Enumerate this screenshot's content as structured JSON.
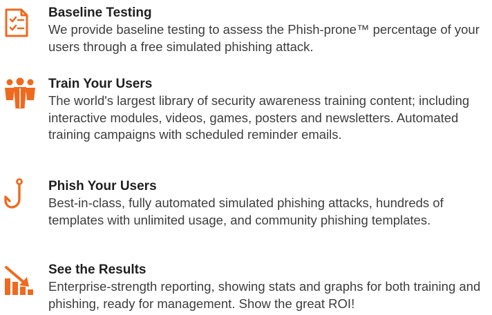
{
  "accent_color": "#ee6a1f",
  "features": [
    {
      "icon": "checklist-icon",
      "title": "Baseline Testing",
      "description": "We provide baseline testing to assess the Phish-prone™ percentage of your users through a free simulated phishing attack."
    },
    {
      "icon": "users-group-icon",
      "title": "Train Your Users",
      "description": "The world's largest library of security awareness training content; including interactive modules, videos, games, posters and newsletters. Automated training campaigns with scheduled reminder emails."
    },
    {
      "icon": "fishing-hook-icon",
      "title": "Phish Your Users",
      "description": "Best-in-class, fully automated simulated phishing attacks, hundreds of templates with unlimited usage, and community phishing templates."
    },
    {
      "icon": "bar-chart-arrow-icon",
      "title": "See the Results",
      "description": "Enterprise-strength reporting, showing stats and graphs for both training and phishing, ready for management. Show the great ROI!"
    }
  ]
}
